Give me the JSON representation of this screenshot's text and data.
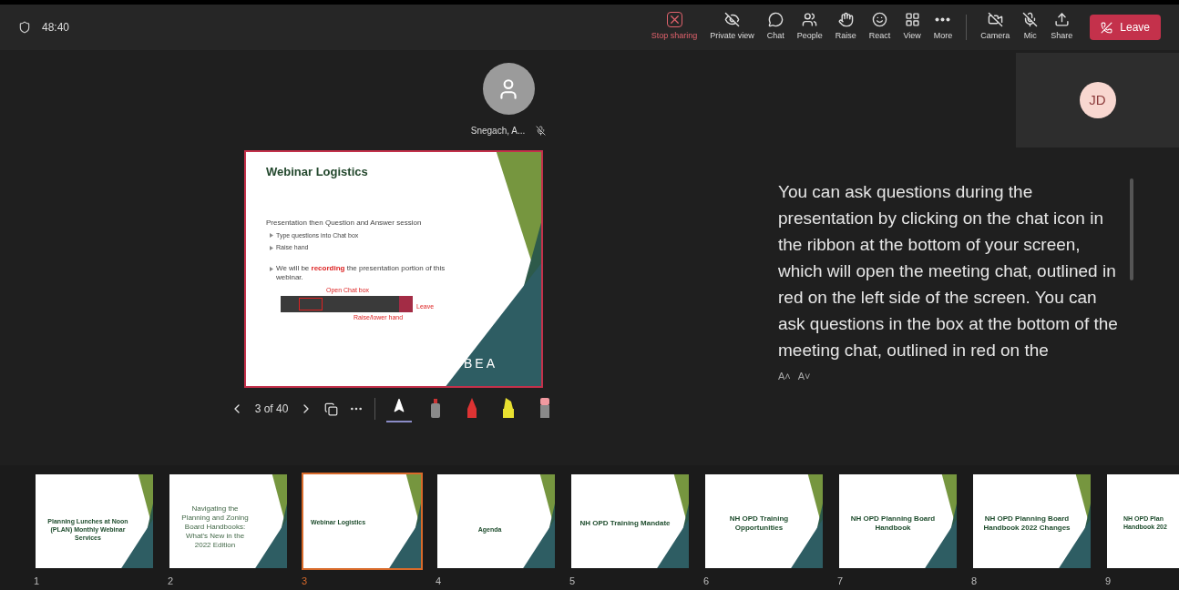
{
  "timer": "48:40",
  "toolbar": [
    {
      "label": "Stop sharing",
      "kind": "stop"
    },
    {
      "label": "Private view",
      "kind": "private"
    },
    {
      "label": "Chat",
      "kind": "chat"
    },
    {
      "label": "People",
      "kind": "people"
    },
    {
      "label": "Raise",
      "kind": "raise"
    },
    {
      "label": "React",
      "kind": "react"
    },
    {
      "label": "View",
      "kind": "view"
    },
    {
      "label": "More",
      "kind": "more"
    },
    {
      "label": "Camera",
      "kind": "camera",
      "off": true
    },
    {
      "label": "Mic",
      "kind": "mic",
      "off": true
    },
    {
      "label": "Share",
      "kind": "share"
    }
  ],
  "leave_button": "Leave",
  "presenter": {
    "name": "Snegach, A...",
    "muted": true
  },
  "participant": {
    "initials": "JD"
  },
  "slide": {
    "title": "Webinar Logistics",
    "heading": "Presentation then Question and Answer session",
    "bullets": [
      "Type questions into Chat box",
      "Raise hand"
    ],
    "note": "We will be **recording** the presentation portion of this webinar.",
    "callouts": [
      "Open Chat box",
      "Raise/lower hand",
      "Leave"
    ],
    "logo": "BEA"
  },
  "slide_controls": {
    "position": "3 of 40",
    "tools": [
      {
        "kind": "pointer",
        "selected": true
      },
      {
        "kind": "pen",
        "selected": false
      },
      {
        "kind": "marker",
        "selected": false
      },
      {
        "kind": "highlighter",
        "selected": false
      },
      {
        "kind": "eraser",
        "selected": false
      }
    ]
  },
  "captions": {
    "text": "You can ask questions during the presentation by clicking on the chat icon in the ribbon at the bottom of your screen, which will open the meeting chat, outlined in red on the left side of the screen. You can ask questions in the box at the bottom of the meeting chat, outlined in red on the",
    "size_controls": [
      "A˄",
      "A˅"
    ]
  },
  "thumbnails": [
    {
      "number": "1",
      "title": "Planning Lunches at Noon (PLAN) Monthly Webinar Services",
      "kind": "cover",
      "selected": false
    },
    {
      "number": "2",
      "title": "Navigating the Planning and Zoning Board Handbooks: What's New in the 2022 Edition",
      "kind": "large",
      "selected": false
    },
    {
      "number": "3",
      "title": "Webinar Logistics",
      "kind": "left",
      "selected": true
    },
    {
      "number": "4",
      "title": "Agenda",
      "kind": "cover",
      "selected": false
    },
    {
      "number": "5",
      "title": "NH OPD Training Mandate",
      "kind": "heading",
      "selected": false
    },
    {
      "number": "6",
      "title": "NH OPD Training Opportunities",
      "kind": "heading",
      "selected": false
    },
    {
      "number": "7",
      "title": "NH OPD Planning Board Handbook",
      "kind": "heading",
      "selected": false
    },
    {
      "number": "8",
      "title": "NH OPD Planning Board Handbook 2022 Changes",
      "kind": "heading",
      "selected": false
    },
    {
      "number": "9",
      "title": "NH OPD Plan\nHandbook 202",
      "kind": "partial",
      "selected": false
    }
  ]
}
